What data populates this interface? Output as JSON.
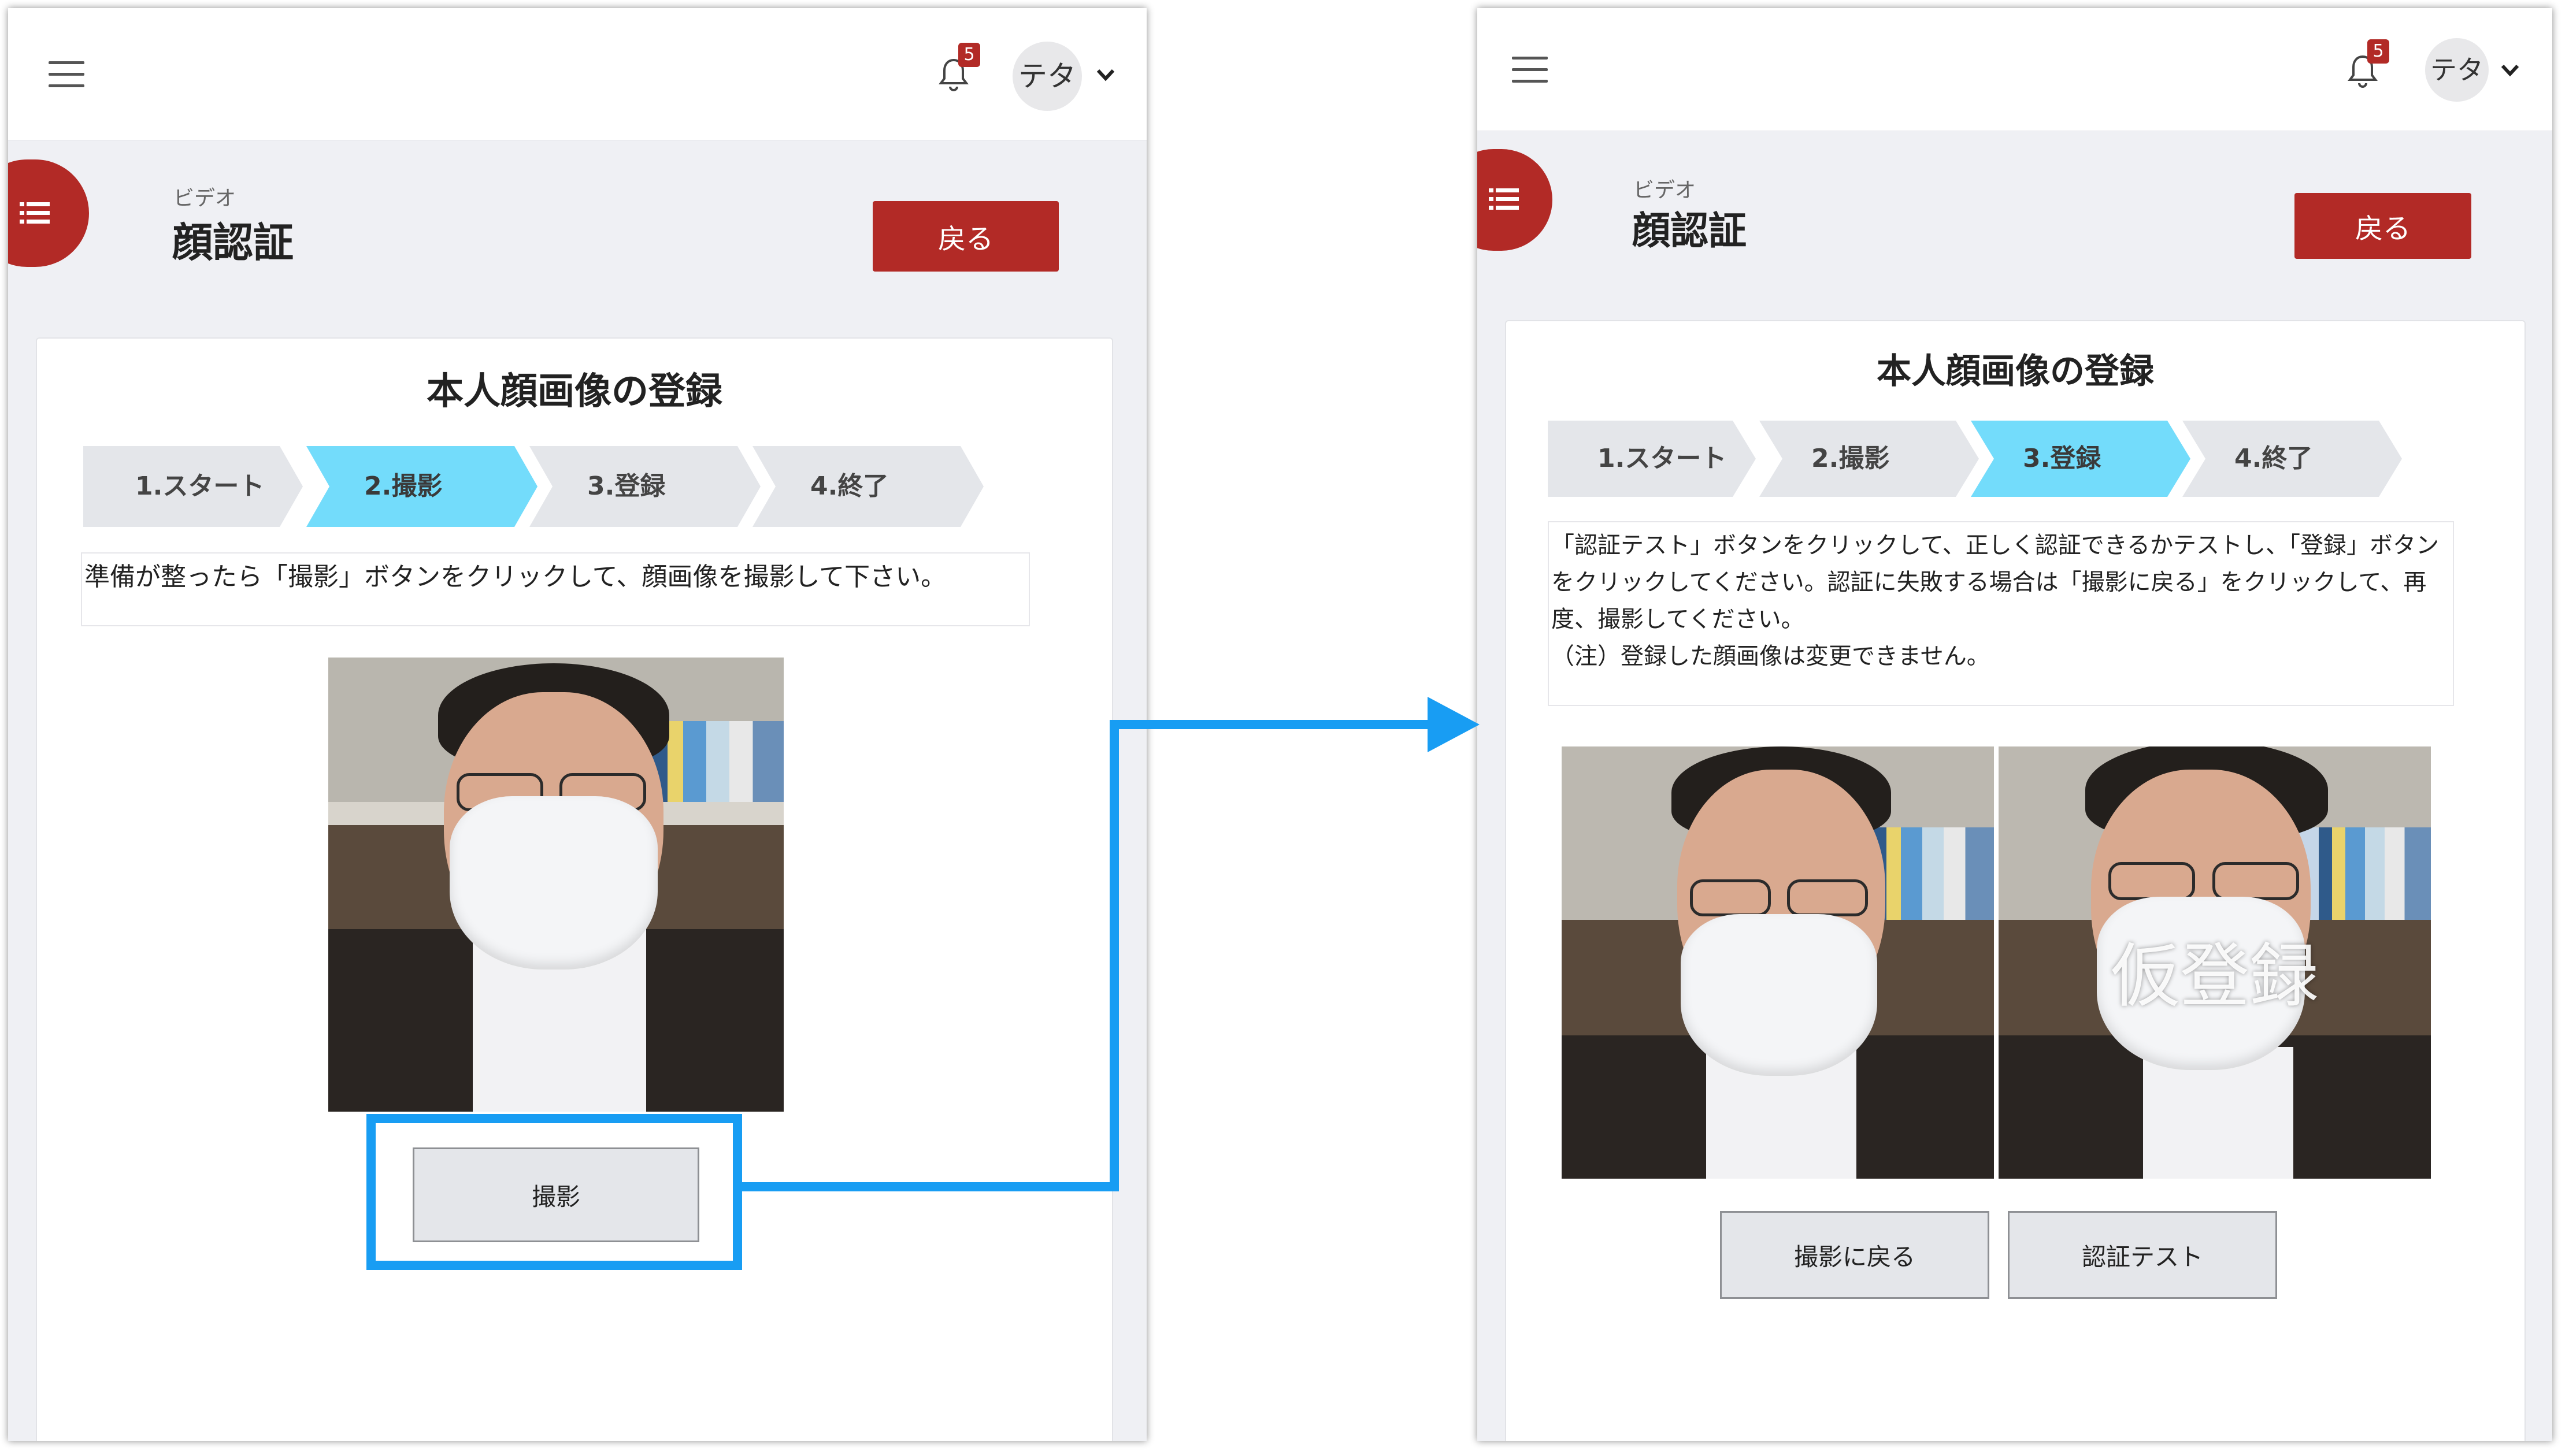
{
  "header": {
    "notification_count": "5",
    "user_name": "テタ"
  },
  "page": {
    "breadcrumb": "ビデオ",
    "title": "顔認証",
    "back_label": "戻る"
  },
  "card": {
    "title": "本人顔画像の登録"
  },
  "steps": [
    "1.スタート",
    "2.撮影",
    "3.登録",
    "4.終了"
  ],
  "left_screen": {
    "active_step": 1,
    "instruction": "準備が整ったら「撮影」ボタンをクリックして、顔画像を撮影して下さい。",
    "capture_label": "撮影"
  },
  "right_screen": {
    "active_step": 2,
    "instruction": "「認証テスト」ボタンをクリックして、正しく認証できるかテストし、「登録」ボタンをクリックしてください。認証に失敗する場合は「撮影に戻る」をクリックして、再度、撮影してください。",
    "note": "（注）登録した顔画像は変更できません。",
    "photo_overlay": "仮登録",
    "retake_label": "撮影に戻る",
    "test_label": "認証テスト"
  },
  "colors": {
    "brand_red": "#b22a26",
    "active_step": "#73dcfb",
    "annotation_blue": "#189df3"
  }
}
